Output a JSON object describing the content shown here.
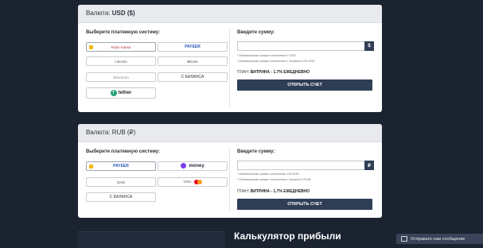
{
  "usd": {
    "header_label": "Валюта:",
    "header_currency": "USD ($)",
    "choose_title": "Выберите платежную систему:",
    "methods": [
      {
        "name": "Robo Kassa",
        "icon": "robokassa-logo"
      },
      {
        "name": "PAYEER",
        "icon": "payeer-logo"
      },
      {
        "name": "Litecoin",
        "icon": "litecoin-logo"
      },
      {
        "name": "Bitcoin",
        "icon": "bitcoin-logo"
      },
      {
        "name": "Ethereum",
        "icon": "ethereum-logo"
      },
      {
        "name": "С БАЛАНСА",
        "icon": ""
      },
      {
        "name": "tether",
        "icon": "tether-logo",
        "sub": "ERC-20"
      }
    ],
    "amount_title": "Введите сумму:",
    "amount_value": "",
    "currency_symbol": "$",
    "note_min": "* Минимальная сумма пополнения 5 USD",
    "note_balance": "* Минимальная сумма пополнения с баланса 0.05 USD",
    "plan_label": "ПЛАН:",
    "plan_value": "ВИТРИНА - 1.7% ЕЖЕДНЕВНО",
    "open_button": "ОТКРЫТЬ СЧЕТ"
  },
  "rub": {
    "header_label": "Валюта:",
    "header_currency": "RUB (₽)",
    "choose_title": "Выберите платежную систему:",
    "methods": [
      {
        "name": "PAYEER",
        "icon": "payeer-logo"
      },
      {
        "name": "money",
        "icon": "yoomoney-logo"
      },
      {
        "name": "QIWI",
        "icon": "qiwi-logo"
      },
      {
        "name": "VISA",
        "icon": "visa-mastercard-logo"
      },
      {
        "name": "С БАЛАНСА",
        "icon": ""
      }
    ],
    "amount_title": "Введите сумму:",
    "amount_value": "",
    "currency_symbol": "₽",
    "note_min": "* Минимальная сумма пополнения 100 RUB",
    "note_balance": "* Минимальная сумма пополнения с баланса 5 RUB",
    "plan_label": "ПЛАН:",
    "plan_value": "ВИТРИНА - 1.7% ЕЖЕДНЕВНО",
    "open_button": "ОТКРЫТЬ СЧЕТ"
  },
  "calculator_title": "Калькулятор прибыли",
  "chat_label": "Отправьте нам сообщение",
  "colors": {
    "background": "#1b2230",
    "button": "#2f3d55",
    "selected": "#f2b800"
  }
}
